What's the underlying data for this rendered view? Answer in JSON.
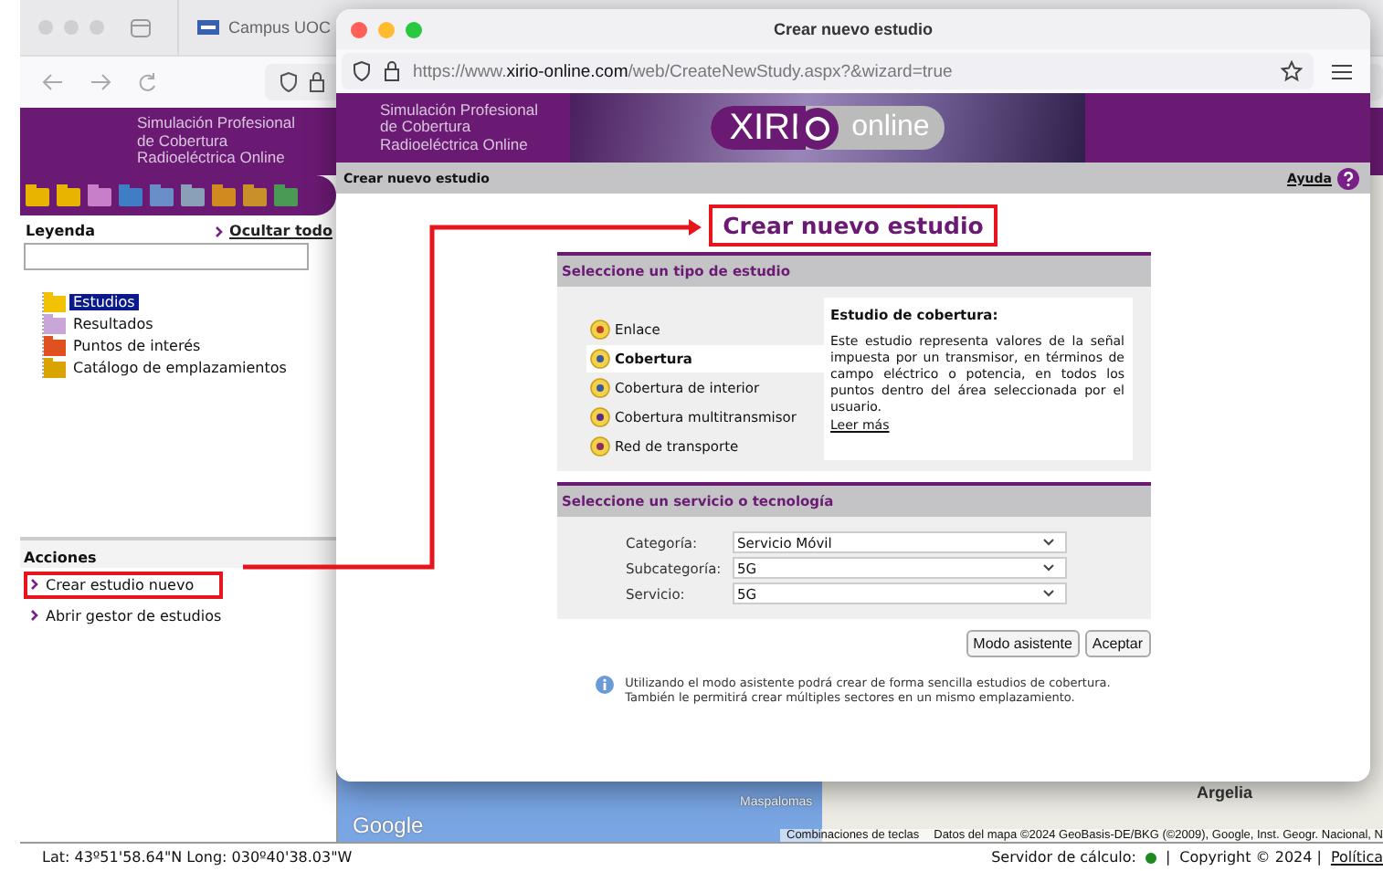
{
  "background_browser": {
    "tab": "Campus UOC"
  },
  "left_banner": [
    "Simulación Profesional",
    "de Cobertura",
    "Radioeléctrica Online"
  ],
  "legend": {
    "title": "Leyenda",
    "hide_all": "Ocultar todo",
    "items": [
      {
        "label": "Estudios",
        "selected": true,
        "kind": "folder"
      },
      {
        "label": "Resultados",
        "selected": false,
        "kind": "results"
      },
      {
        "label": "Puntos de interés",
        "selected": false,
        "kind": "poi"
      },
      {
        "label": "Catálogo de emplazamientos",
        "selected": false,
        "kind": "catalog"
      }
    ]
  },
  "actions": {
    "title": "Acciones",
    "items": [
      {
        "label": "Crear estudio nuevo",
        "highlighted": true
      },
      {
        "label": "Abrir gestor de estudios",
        "highlighted": false
      }
    ]
  },
  "map": {
    "labels": [
      {
        "text": "Maspalomas",
        "kind": "town"
      },
      {
        "text": "Argelia",
        "kind": "country"
      }
    ],
    "logo": "Google",
    "shortcuts": "Combinaciones de teclas",
    "attribution": "Datos del mapa ©2024 GeoBasis-DE/BKG (©2009), Google, Inst. Geogr. Nacional, N"
  },
  "status_bar": {
    "coordinates": "Lat: 43º51'58.64\"N Long: 030º40'38.03\"W",
    "server_label": "Servidor de cálculo:",
    "server_online": true,
    "separator": "|",
    "copyright": "Copyright © 2024 |",
    "policy_link": "Política"
  },
  "dialog": {
    "title": "Crear nuevo estudio",
    "url": "https://www.**xirio-online.com**/web/CreateNewStudy.aspx?&wizard=true",
    "banner": [
      "Simulación Profesional",
      "de Cobertura",
      "Radioeléctrica Online"
    ],
    "logo": {
      "main": "XIRI",
      "sub": "online"
    },
    "breadcrumb": "Crear nuevo estudio",
    "help": "Ayuda",
    "heading": "Crear nuevo estudio",
    "heading_highlighted": true,
    "study_panel": {
      "title": "Seleccione un tipo de estudio",
      "types": [
        {
          "label": "Enlace",
          "selected": false
        },
        {
          "label": "Cobertura",
          "selected": true
        },
        {
          "label": "Cobertura de interior",
          "selected": false
        },
        {
          "label": "Cobertura multitransmisor",
          "selected": false
        },
        {
          "label": "Red de transporte",
          "selected": false
        }
      ],
      "description": {
        "title": "Estudio de cobertura:",
        "text": "Este estudio representa valores de la señal impuesta por un transmisor, en términos de campo eléctrico o potencia, en todos los puntos dentro del área seleccionada por el usuario.",
        "more": "Leer más"
      }
    },
    "service_panel": {
      "title": "Seleccione un servicio o tecnología",
      "fields": [
        {
          "label": "Categoría:",
          "value": "Servicio Móvil"
        },
        {
          "label": "Subcategoría:",
          "value": "5G"
        },
        {
          "label": "Servicio:",
          "value": "5G"
        }
      ]
    },
    "buttons": [
      "Modo asistente",
      "Aceptar"
    ],
    "info": [
      "Utilizando el modo asistente podrá crear de forma sencilla estudios de cobertura.",
      "También le permitirá crear múltiples sectores en un mismo emplazamiento."
    ]
  }
}
